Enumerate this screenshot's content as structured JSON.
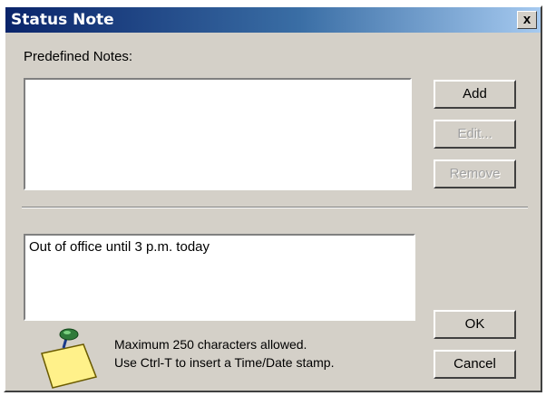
{
  "window": {
    "title": "Status Note",
    "close_label": "x"
  },
  "predefined": {
    "label": "Predefined Notes:",
    "items": []
  },
  "buttons": {
    "add": "Add",
    "edit": "Edit...",
    "remove": "Remove",
    "ok": "OK",
    "cancel": "Cancel"
  },
  "note": {
    "value": "Out of office until 3 p.m. today"
  },
  "hint": {
    "line1": "Maximum 250 characters allowed.",
    "line2": "Use Ctrl-T to insert a Time/Date stamp."
  },
  "icons": {
    "note_icon": "sticky-note-pin-icon"
  }
}
